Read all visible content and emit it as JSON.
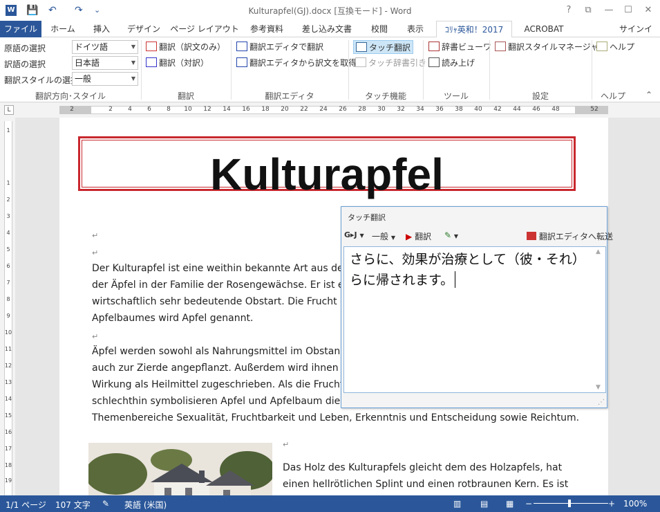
{
  "window": {
    "app_icon": "W",
    "title": "Kulturapfel(GJ).docx [互換モード] - Word",
    "help": "?",
    "restore_ribbon": "⧉",
    "minimize": "—",
    "maximize": "☐",
    "close": "✕",
    "qa_save": "💾",
    "qa_undo": "↶",
    "qa_redo": "↷",
    "qa_more": "⌄"
  },
  "tabs": [
    {
      "label": "ファイル"
    },
    {
      "label": "ホーム"
    },
    {
      "label": "挿入"
    },
    {
      "label": "デザイン"
    },
    {
      "label": "ページ レイアウト"
    },
    {
      "label": "参考資料"
    },
    {
      "label": "差し込み文書"
    },
    {
      "label": "校閲"
    },
    {
      "label": "表示"
    },
    {
      "label": "ｺﾘｬ英和！2017"
    },
    {
      "label": "ACROBAT"
    }
  ],
  "signin": "サインイン",
  "ribbon": {
    "source_lang_label": "原語の選択",
    "source_lang_value": "ドイツ語",
    "target_lang_label": "訳語の選択",
    "target_lang_value": "日本語",
    "style_label": "翻訳スタイルの選択",
    "style_value": "一般",
    "group1": "翻訳方向･スタイル",
    "btn_translate_only": "翻訳（訳文のみ）",
    "btn_translate_pair": "翻訳（対訳）",
    "group2": "翻訳",
    "btn_editor_translate": "翻訳エディタで翻訳",
    "btn_editor_fetch": "翻訳エディタから訳文を取得",
    "group3": "翻訳エディタ",
    "btn_touch_translate": "タッチ翻訳",
    "btn_touch_dict": "タッチ辞書引き",
    "group4": "タッチ機能",
    "btn_dict_viewer": "辞書ビューワ",
    "btn_read_aloud": "読み上げ",
    "group5": "ツール",
    "btn_style_manager": "翻訳スタイルマネージャ",
    "group6": "設定",
    "btn_help": "ヘルプ",
    "group7": "ヘルプ",
    "collapse": "⌃"
  },
  "ruler": {
    "corner": "L",
    "numbers": [
      "2",
      "2",
      "4",
      "6",
      "8",
      "10",
      "12",
      "14",
      "16",
      "18",
      "20",
      "22",
      "24",
      "26",
      "28",
      "30",
      "32",
      "34",
      "36",
      "38",
      "40",
      "42",
      "44",
      "46",
      "48",
      "52"
    ],
    "vnumbers": [
      "1",
      "1",
      "2",
      "3",
      "4",
      "5",
      "6",
      "7",
      "8",
      "9",
      "10",
      "11",
      "12",
      "13",
      "14",
      "15",
      "16",
      "17",
      "18",
      "19",
      "20",
      "21",
      "22"
    ]
  },
  "document": {
    "title": "Kulturapfel",
    "para_mark": "↵",
    "lines": [
      " Der Kulturapfel ist eine weithin bekannte Art aus der",
      "der Äpfel in der Familie der Rosengewächse. Er ist ein",
      "wirtschaftlich sehr bedeutende Obstart. Die Frucht de",
      "Apfelbaumes wird Apfel genannt.",
      "Äpfel werden sowohl als Nahrungsmittel im Obstanba",
      "auch zur Zierde angepflanzt. Außerdem wird ihnen e",
      "Wirkung als Heilmittel zugeschrieben. Als die Frucht",
      "schlechthin symbolisieren Apfel und Apfelbaum die",
      "Themenbereiche Sexualität, Fruchtbarkeit und Leben, Erkenntnis und Entscheidung sowie Reichtum.",
      "Das Holz des Kulturapfels gleicht dem des Holzapfels, hat",
      "einen hellrötlichen Splint und einen rotbraunen Kern. Es ist"
    ]
  },
  "popup": {
    "title": "タッチ翻訳",
    "direction": "G▸J",
    "style": "一般",
    "translate_btn": "翻訳",
    "tool_btn": "✎",
    "transfer_btn": "翻訳エディタへ転送",
    "text": "さらに、効果が治療として（彼・それ）らに帰されます。"
  },
  "status": {
    "page": "1/1 ページ",
    "words": "107 文字",
    "lang": "英語 (米国)",
    "zoom": "100%"
  }
}
